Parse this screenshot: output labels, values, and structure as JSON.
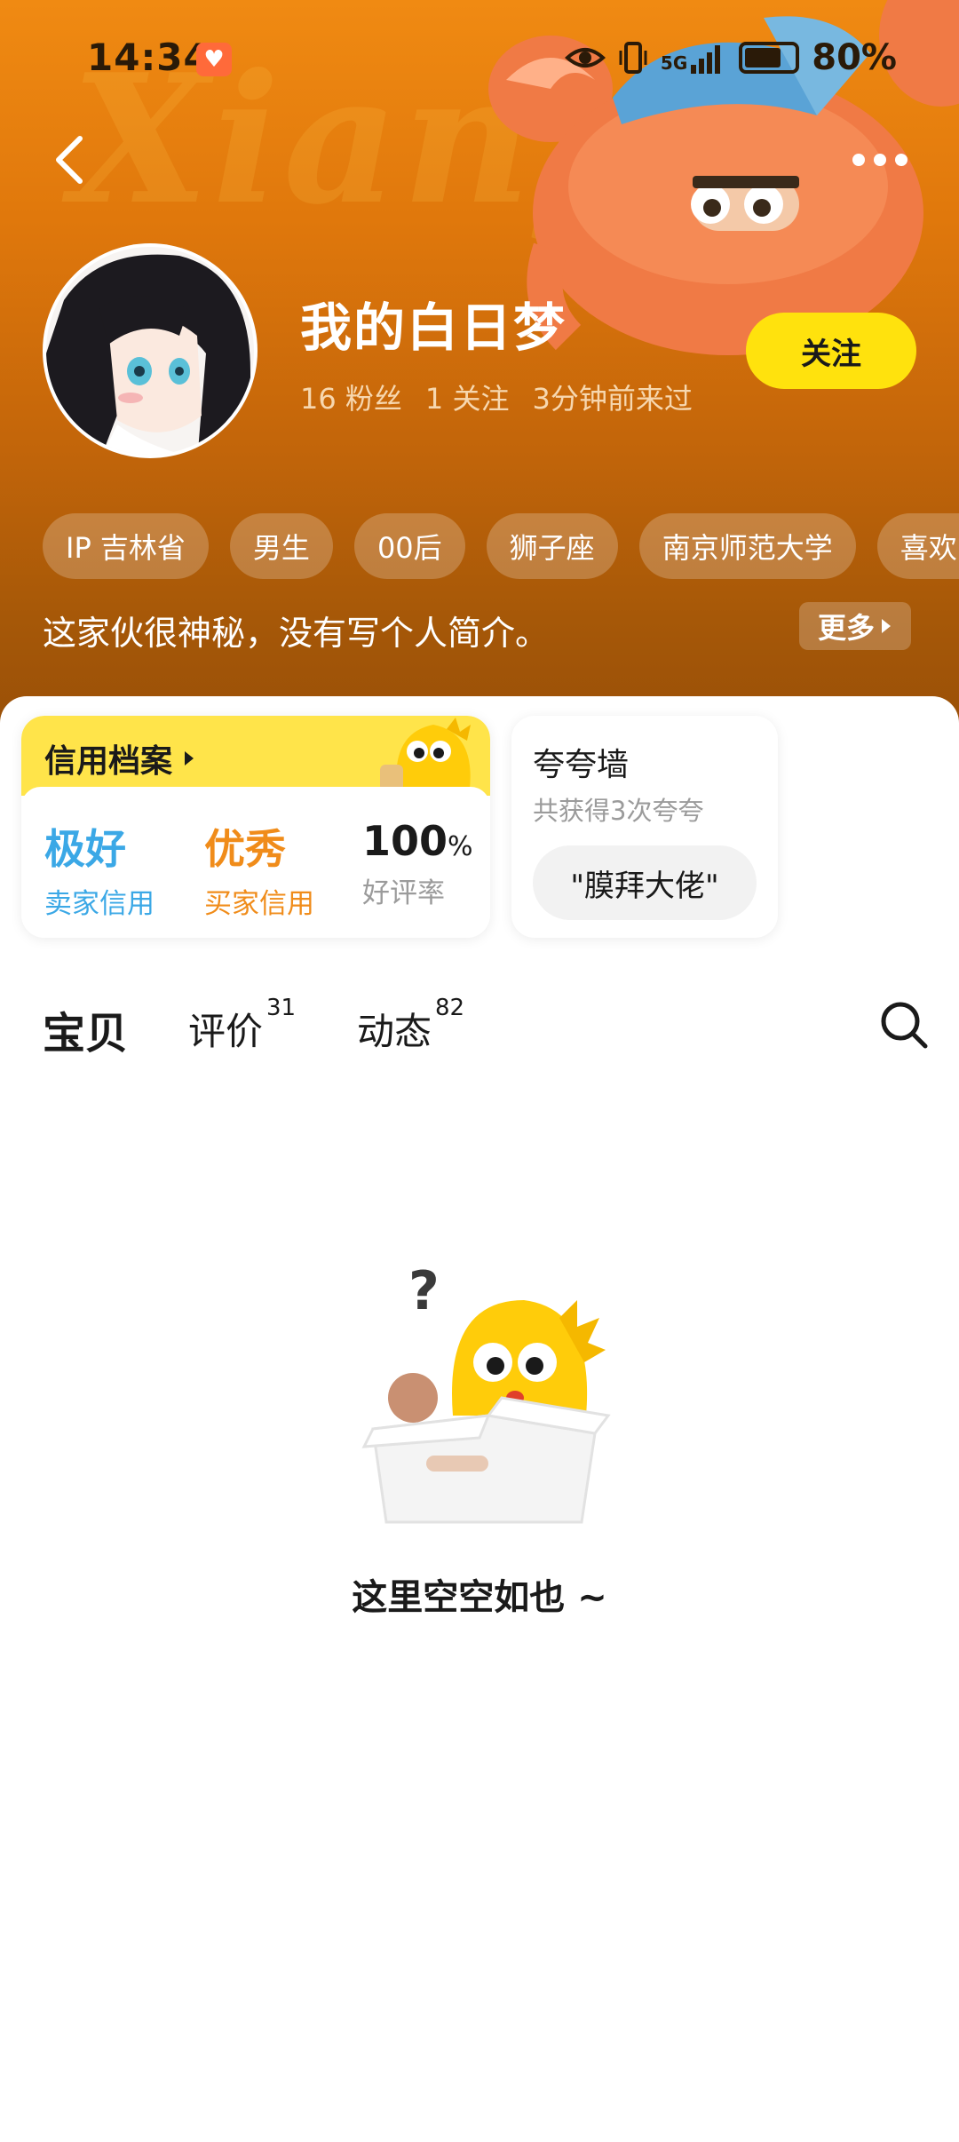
{
  "status_bar": {
    "time": "14:34",
    "network": "5G",
    "battery_percent": "80%"
  },
  "profile": {
    "username": "我的白日梦",
    "followers": "16 粉丝",
    "following": "1 关注",
    "last_seen": "3分钟前来过",
    "follow_label": "关注",
    "tags": [
      "IP 吉林省",
      "男生",
      "00后",
      "狮子座",
      "南京师范大学",
      "喜欢D"
    ],
    "bio": "这家伙很神秘，没有写个人简介。",
    "more_label": "更多",
    "watermark": "Xianyu"
  },
  "credit": {
    "title": "信用档案",
    "items": [
      {
        "value": "极好",
        "label": "卖家信用",
        "color": "#3ba8e6"
      },
      {
        "value": "优秀",
        "label": "买家信用",
        "color": "#f08c1a"
      },
      {
        "value": "100",
        "unit": "%",
        "label": "好评率",
        "color": "#1a1a1a"
      }
    ]
  },
  "praise": {
    "title": "夸夸墙",
    "subtitle": "共获得3次夸夸",
    "chip": "\"膜拜大佬\""
  },
  "tabs": [
    {
      "label": "宝贝",
      "count": "",
      "active": true
    },
    {
      "label": "评价",
      "count": "31",
      "active": false
    },
    {
      "label": "动态",
      "count": "82",
      "active": false
    }
  ],
  "empty_state": {
    "text": "这里空空如也 ~"
  },
  "colors": {
    "accent_yellow": "#ffe20d",
    "header_orange": "#e0780c"
  }
}
